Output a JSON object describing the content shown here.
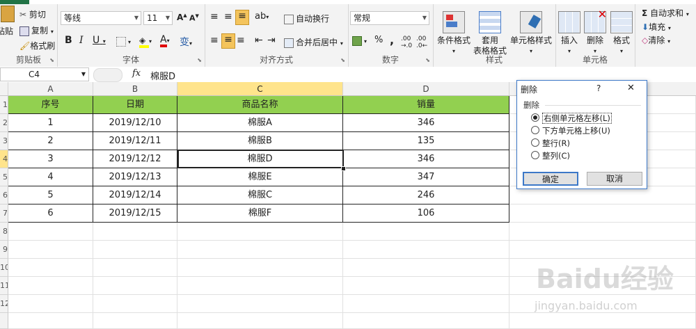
{
  "ribbon": {
    "clipboard": {
      "paste": "粘贴",
      "cut": "剪切",
      "copy": "复制",
      "format_painter": "格式刷",
      "label": "剪贴板"
    },
    "font": {
      "name": "等线",
      "size": "11",
      "bold": "B",
      "italic": "I",
      "underline": "U",
      "font_color": "A",
      "phonetic": "变",
      "label": "字体"
    },
    "alignment": {
      "wrap": "自动换行",
      "merge": "合并后居中",
      "label": "对齐方式"
    },
    "number": {
      "format": "常规",
      "percent": "%",
      "comma": ",",
      "label": "数字"
    },
    "styles": {
      "conditional": "条件格式",
      "table": "套用\n表格格式",
      "cell": "单元格样式",
      "label": "样式"
    },
    "cells": {
      "insert": "插入",
      "delete": "删除",
      "format": "格式",
      "label": "单元格"
    },
    "editing": {
      "autosum": "自动求和",
      "fill": "填充",
      "clear": "清除"
    }
  },
  "formula_bar": {
    "name_box": "C4",
    "fx": "fx",
    "content": "棉服D"
  },
  "columns": [
    "A",
    "B",
    "C",
    "D"
  ],
  "rows": [
    "1",
    "2",
    "3",
    "4",
    "5",
    "6",
    "7",
    "8",
    "9",
    "10",
    "11",
    "12"
  ],
  "table": {
    "headers": [
      "序号",
      "日期",
      "商品名称",
      "销量"
    ],
    "rows": [
      [
        "1",
        "2019/12/10",
        "棉服A",
        "346"
      ],
      [
        "2",
        "2019/12/11",
        "棉服B",
        "135"
      ],
      [
        "3",
        "2019/12/12",
        "棉服D",
        "346"
      ],
      [
        "4",
        "2019/12/13",
        "棉服E",
        "347"
      ],
      [
        "5",
        "2019/12/14",
        "棉服C",
        "246"
      ],
      [
        "6",
        "2019/12/15",
        "棉服F",
        "106"
      ]
    ]
  },
  "dialog": {
    "title": "删除",
    "help": "?",
    "close": "✕",
    "group_label": "删除",
    "options": [
      "右侧单元格左移(L)",
      "下方单元格上移(U)",
      "整行(R)",
      "整列(C)"
    ],
    "selected": 0,
    "ok": "确定",
    "cancel": "取消"
  },
  "watermark": {
    "brand": "Baidu经验",
    "url": "jingyan.baidu.com"
  },
  "colors": {
    "header_green": "#92d050",
    "excel_green": "#217346",
    "selection_yellow": "#ffe48c"
  }
}
